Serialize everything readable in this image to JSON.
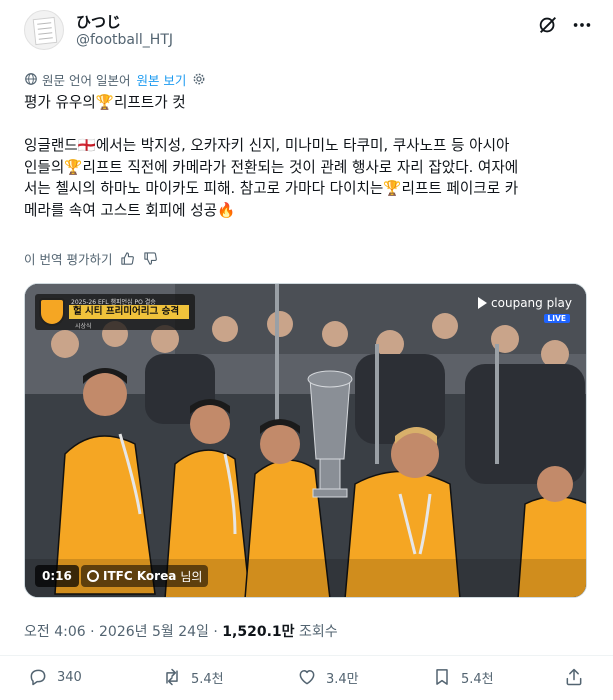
{
  "author": {
    "display_name": "ひつじ",
    "handle": "@football_HTJ"
  },
  "translation_bar": {
    "original_language_text": "원문 언어 일본어",
    "show_original_label": "원본 보기"
  },
  "tweet": {
    "line1": "평가 유우의🏆리프트가 컷",
    "paragraph2": "잉글랜드🏴󠁧󠁢󠁥󠁮󠁧󠁿에서는 박지성, 오카자키 신지, 미나미노 타쿠미, 쿠사노프 등 아시아\n인들의🏆리프트 직전에 카메라가 전환되는 것이 관례 행사로 자리 잡았다. 여자에\n서는 첼시의 하마노 마이카도 피해. 참고로 가마다 다이치는🏆리프트 페이크로 카\n메라를 속여 고스트 회피에 성공🔥"
  },
  "rate_translation": {
    "label": "이 번역 평가하기"
  },
  "media": {
    "overlay_top_line": "2025-26 EFL 챔피언십 PO 결승",
    "overlay_title": "헐 시티 프리미어리그 승격",
    "overlay_sub": "시상식",
    "broadcaster": "coupang play",
    "live_label": "LIVE",
    "timestamp": "0:16",
    "credit_name": "ITFC Korea",
    "credit_suffix": "님의"
  },
  "meta": {
    "time": "오전 4:06",
    "date": "2026년 5월 24일",
    "separator": " · ",
    "views_count": "1,520.1만",
    "views_label": "조회수"
  },
  "actions": {
    "replies": "340",
    "reposts": "5.4천",
    "likes": "3.4만",
    "bookmarks": "5.4천"
  },
  "colors": {
    "accent": "#1d9bf0",
    "secondary_text": "#536471",
    "primary_text": "#0f1419",
    "kit_orange": "#f5a623"
  }
}
